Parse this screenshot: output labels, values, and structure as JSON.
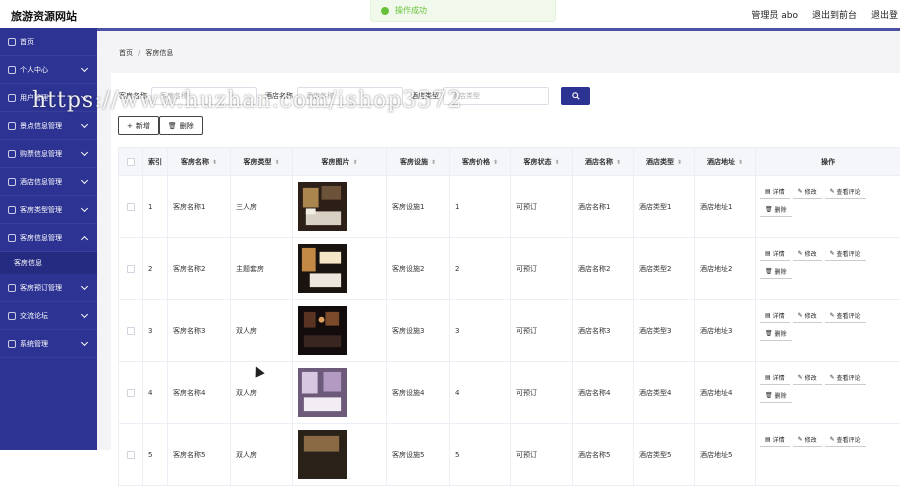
{
  "app": {
    "title": "旅游资源网站"
  },
  "header": {
    "admin": "管理员 abo",
    "frontend": "退出到前台",
    "logout": "退出登"
  },
  "toast": {
    "message": "操作成功"
  },
  "sidebar": {
    "items": [
      {
        "label": "首页",
        "chevron": "none"
      },
      {
        "label": "个人中心",
        "chevron": "down"
      },
      {
        "label": "用户管理",
        "chevron": "down"
      },
      {
        "label": "景点信息管理",
        "chevron": "down"
      },
      {
        "label": "购票信息管理",
        "chevron": "down"
      },
      {
        "label": "酒店信息管理",
        "chevron": "down"
      },
      {
        "label": "客房类型管理",
        "chevron": "down"
      },
      {
        "label": "客房信息管理",
        "chevron": "up"
      },
      {
        "label": "客房预订管理",
        "chevron": "down"
      },
      {
        "label": "交流论坛",
        "chevron": "down"
      },
      {
        "label": "系统管理",
        "chevron": "down"
      }
    ],
    "sub_item": "客房信息"
  },
  "breadcrumb": {
    "home": "首页",
    "sep": "/",
    "current": "客房信息"
  },
  "search": {
    "room_name_label": "客房名称",
    "room_name_placeholder": "客房名称",
    "hotel_name_label": "酒店名称",
    "hotel_name_placeholder": "酒店名称",
    "hotel_type_label": "酒店类型",
    "hotel_type_placeholder": "酒店类型"
  },
  "toolbar": {
    "add": "新增",
    "delete": "删除"
  },
  "table": {
    "headers": [
      "索引",
      "客房名称",
      "客房类型",
      "客房图片",
      "客房设施",
      "客房价格",
      "客房状态",
      "酒店名称",
      "酒店类型",
      "酒店地址",
      "操作"
    ],
    "rows": [
      {
        "index": "1",
        "name": "客房名称1",
        "type": "三人房",
        "facility": "客房设施1",
        "price": "1",
        "status": "可预订",
        "hotel": "酒店名称1",
        "hotel_type": "酒店类型1",
        "address": "酒店地址1"
      },
      {
        "index": "2",
        "name": "客房名称2",
        "type": "主题套房",
        "facility": "客房设施2",
        "price": "2",
        "status": "可预订",
        "hotel": "酒店名称2",
        "hotel_type": "酒店类型2",
        "address": "酒店地址2"
      },
      {
        "index": "3",
        "name": "客房名称3",
        "type": "双人房",
        "facility": "客房设施3",
        "price": "3",
        "status": "可预订",
        "hotel": "酒店名称3",
        "hotel_type": "酒店类型3",
        "address": "酒店地址3"
      },
      {
        "index": "4",
        "name": "客房名称4",
        "type": "双人房",
        "facility": "客房设施4",
        "price": "4",
        "status": "可预订",
        "hotel": "酒店名称4",
        "hotel_type": "酒店类型4",
        "address": "酒店地址4"
      },
      {
        "index": "5",
        "name": "客房名称5",
        "type": "双人房",
        "facility": "客房设施5",
        "price": "5",
        "status": "可预订",
        "hotel": "酒店名称5",
        "hotel_type": "酒店类型5",
        "address": "酒店地址5"
      }
    ],
    "ops": {
      "detail": "详情",
      "edit": "修改",
      "review": "查看评论",
      "delete": "删除"
    }
  },
  "watermark": "https://www.huzhan.com/ishop3572",
  "colors": {
    "sidebar": "#2d3393",
    "accent": "#2d3393",
    "toast_text": "#67c23a"
  }
}
